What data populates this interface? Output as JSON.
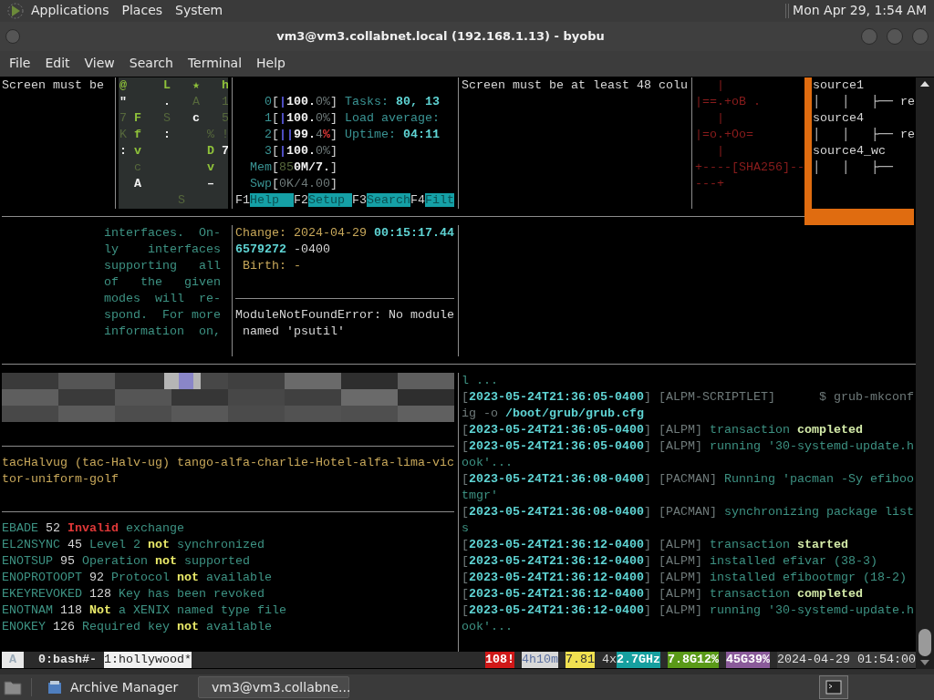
{
  "top_panel": {
    "menus": [
      "Applications",
      "Places",
      "System"
    ],
    "clock": "Mon Apr 29, 1:54 AM"
  },
  "window": {
    "title": "vm3@vm3.collabnet.local (192.168.1.13) - byobu",
    "menu": [
      "File",
      "Edit",
      "View",
      "Search",
      "Terminal",
      "Help"
    ]
  },
  "terminal": {
    "top_panes": [
      {
        "kind": "plain",
        "lines": [
          [
            {
              "text": "Screen must be",
              "kind": "text"
            }
          ]
        ]
      },
      {
        "kind": "shaded",
        "lines": [
          [
            {
              "text": "@     L   ★   h",
              "kind": "lime"
            }
          ],
          [
            {
              "text": "\"     .",
              "kind": "bold"
            },
            {
              "text": "   A   1",
              "kind": "olive"
            }
          ],
          [
            {
              "text": "7 ",
              "kind": "olive"
            },
            {
              "text": "F",
              "kind": "lime"
            },
            {
              "text": "   S   ",
              "kind": "olive"
            },
            {
              "text": "c",
              "kind": "bold"
            },
            {
              "text": "   5",
              "kind": "olive"
            }
          ],
          [
            {
              "text": "K ",
              "kind": "olive"
            },
            {
              "text": "f",
              "kind": "lime"
            },
            {
              "text": "   :",
              "kind": "bold"
            },
            {
              "text": "     % !",
              "kind": "olive"
            }
          ],
          [
            {
              "text": ":",
              "kind": "bold"
            },
            {
              "text": " v         D",
              "kind": "lime"
            },
            {
              "text": " 7",
              "kind": "bold"
            }
          ],
          [
            {
              "text": "  c",
              "kind": "olive"
            },
            {
              "text": "         v",
              "kind": "lime"
            }
          ],
          [
            {
              "text": "  A         –",
              "kind": "bold"
            }
          ],
          [
            {
              "text": "        S",
              "kind": "olive"
            }
          ]
        ]
      },
      {
        "kind": "offset",
        "lines": [
          [
            {
              "text": "    0",
              "kind": "teal"
            },
            {
              "text": "[",
              "kind": "text"
            },
            {
              "text": "|",
              "kind": "blue"
            },
            {
              "text": "100.",
              "kind": "bold"
            },
            {
              "text": "0%",
              "kind": "grey"
            },
            {
              "text": "]",
              "kind": "text"
            },
            {
              "text": " Tasks: ",
              "kind": "teal"
            },
            {
              "text": "80, 13",
              "kind": "cyan"
            }
          ],
          [
            {
              "text": "    1",
              "kind": "teal"
            },
            {
              "text": "[",
              "kind": "text"
            },
            {
              "text": "|",
              "kind": "blue"
            },
            {
              "text": "100.",
              "kind": "bold"
            },
            {
              "text": "0%",
              "kind": "grey"
            },
            {
              "text": "]",
              "kind": "text"
            },
            {
              "text": " Load average:",
              "kind": "teal"
            }
          ],
          [
            {
              "text": "    2",
              "kind": "teal"
            },
            {
              "text": "[",
              "kind": "text"
            },
            {
              "text": "||",
              "kind": "blue"
            },
            {
              "text": "99.",
              "kind": "bold"
            },
            {
              "text": "4",
              "kind": "grey"
            },
            {
              "text": "%",
              "kind": "red"
            },
            {
              "text": "]",
              "kind": "text"
            },
            {
              "text": " Uptime: ",
              "kind": "teal"
            },
            {
              "text": "04:11",
              "kind": "cyan"
            }
          ],
          [
            {
              "text": "    3",
              "kind": "teal"
            },
            {
              "text": "[",
              "kind": "text"
            },
            {
              "text": "|",
              "kind": "blue"
            },
            {
              "text": "100.",
              "kind": "bold"
            },
            {
              "text": "0%",
              "kind": "grey"
            },
            {
              "text": "]",
              "kind": "text"
            }
          ],
          [
            {
              "text": "  Mem",
              "kind": "teal"
            },
            {
              "text": "[",
              "kind": "text"
            },
            {
              "text": "85",
              "kind": "olive"
            },
            {
              "text": "0M/7.",
              "kind": "bold"
            },
            {
              "text": "]",
              "kind": "text"
            }
          ],
          [
            {
              "text": "  Swp",
              "kind": "teal"
            },
            {
              "text": "[",
              "kind": "text"
            },
            {
              "text": "0K/4.00",
              "kind": "grey"
            },
            {
              "text": "]",
              "kind": "text"
            }
          ],
          [
            {
              "text": "F1",
              "kind": "text"
            },
            {
              "text": "Help  ",
              "kind": "key"
            },
            {
              "text": "F2",
              "kind": "text"
            },
            {
              "text": "Setup ",
              "kind": "key"
            },
            {
              "text": "F3",
              "kind": "text"
            },
            {
              "text": "Search",
              "kind": "key"
            },
            {
              "text": "F4",
              "kind": "text"
            },
            {
              "text": "Filt",
              "kind": "key"
            }
          ]
        ]
      },
      {
        "kind": "plain",
        "lines": [
          [
            {
              "text": "Screen must be at least 48 colu",
              "kind": "text"
            }
          ]
        ]
      },
      {
        "kind": "plain",
        "lines": [
          [
            {
              "text": "   |",
              "kind": "darkred"
            }
          ],
          [
            {
              "text": "|==.+oB .",
              "kind": "darkred"
            }
          ],
          [
            {
              "text": "   |",
              "kind": "darkred"
            }
          ],
          [
            {
              "text": "|=o.+Oo=",
              "kind": "darkred"
            }
          ],
          [
            {
              "text": "   |",
              "kind": "darkred"
            }
          ],
          [
            {
              "text": "+----[SHA256]--",
              "kind": "darkred"
            }
          ],
          [
            {
              "text": "---+",
              "kind": "darkred"
            }
          ]
        ]
      }
    ],
    "tree_pane": {
      "lines": [
        [
          {
            "text": "source1",
            "kind": "text"
          }
        ],
        [
          {
            "text": "│   │   ├── re",
            "kind": "text"
          }
        ],
        [
          {
            "text": "source4",
            "kind": "text"
          }
        ],
        [
          {
            "text": "│   │   ├── re",
            "kind": "text"
          }
        ],
        [
          {
            "text": "source4_wc",
            "kind": "text"
          }
        ],
        [
          {
            "text": "│   │   ├──",
            "kind": "text"
          }
        ]
      ]
    },
    "man_pane": {
      "lines": [
        [
          {
            "text": "interfaces.  On-",
            "kind": "dim"
          }
        ],
        [
          {
            "text": "ly    interfaces",
            "kind": "dim"
          }
        ],
        [
          {
            "text": "supporting   all",
            "kind": "dim"
          }
        ],
        [
          {
            "text": "of   the   given",
            "kind": "dim"
          }
        ],
        [
          {
            "text": "modes  will  re-",
            "kind": "dim"
          }
        ],
        [
          {
            "text": "spond.  For more",
            "kind": "dim"
          }
        ],
        [
          {
            "text": "information  on,",
            "kind": "dim"
          }
        ]
      ]
    },
    "stat_pane": {
      "lines": [
        [
          {
            "text": "Change:",
            "kind": "gold"
          },
          {
            "text": " 2024-04-29 ",
            "kind": "gold"
          },
          {
            "text": "00:15:17.44",
            "kind": "cyan"
          }
        ],
        [
          {
            "text": "6579272",
            "kind": "cyan"
          },
          {
            "text": " -0400",
            "kind": "text"
          }
        ],
        [
          {
            "text": " Birth: -",
            "kind": "gold"
          }
        ]
      ]
    },
    "error_pane": {
      "lines": [
        [
          {
            "text": "ModuleNotFoundError: No module",
            "kind": "text"
          }
        ],
        [
          {
            "text": " named 'psutil'",
            "kind": "text"
          }
        ]
      ]
    },
    "word_pane": {
      "lines": [
        [
          {
            "text": "tacHalvug (tac-Halv-ug) tango-alfa-charlie-Hotel-alfa-lima-vic",
            "kind": "gold"
          }
        ],
        [
          {
            "text": "tor-uniform-golf",
            "kind": "gold"
          }
        ]
      ]
    },
    "errno_pane": {
      "lines": [
        [
          {
            "text": "EBADE",
            "kind": "dim"
          },
          {
            "text": " 52 ",
            "kind": "text"
          },
          {
            "text": "Invalid",
            "kind": "red"
          },
          {
            "text": " exchange",
            "kind": "dim"
          }
        ],
        [
          {
            "text": "EL2NSYNC",
            "kind": "dim"
          },
          {
            "text": " 45 ",
            "kind": "text"
          },
          {
            "text": "Level 2 ",
            "kind": "dim"
          },
          {
            "text": "not",
            "kind": "yellow"
          },
          {
            "text": " synchronized",
            "kind": "dim"
          }
        ],
        [
          {
            "text": "ENOTSUP",
            "kind": "dim"
          },
          {
            "text": " 95 ",
            "kind": "text"
          },
          {
            "text": "Operation ",
            "kind": "dim"
          },
          {
            "text": "not",
            "kind": "yellow"
          },
          {
            "text": " supported",
            "kind": "dim"
          }
        ],
        [
          {
            "text": "ENOPROTOOPT",
            "kind": "dim"
          },
          {
            "text": " 92 ",
            "kind": "text"
          },
          {
            "text": "Protocol ",
            "kind": "dim"
          },
          {
            "text": "not",
            "kind": "yellow"
          },
          {
            "text": " available",
            "kind": "dim"
          }
        ],
        [
          {
            "text": "EKEYREVOKED",
            "kind": "dim"
          },
          {
            "text": " 128 ",
            "kind": "text"
          },
          {
            "text": "Key has been revoked",
            "kind": "dim"
          }
        ],
        [
          {
            "text": "ENOTNAM",
            "kind": "dim"
          },
          {
            "text": " 118 ",
            "kind": "text"
          },
          {
            "text": "Not",
            "kind": "yellow"
          },
          {
            "text": " a XENIX named type file",
            "kind": "dim"
          }
        ],
        [
          {
            "text": "ENOKEY",
            "kind": "dim"
          },
          {
            "text": " 126 ",
            "kind": "text"
          },
          {
            "text": "Required key ",
            "kind": "dim"
          },
          {
            "text": "not",
            "kind": "yellow"
          },
          {
            "text": " available",
            "kind": "dim"
          }
        ]
      ]
    },
    "log_pane": {
      "lines": [
        [
          {
            "text": "l ...",
            "kind": "dim"
          }
        ],
        [
          {
            "text": "[",
            "kind": "grey"
          },
          {
            "text": "2023-05-24T21:36:05-0400",
            "kind": "cyan"
          },
          {
            "text": "] [ALPM-SCRIPTLET]      $ grub-mkconf",
            "kind": "grey"
          }
        ],
        [
          {
            "text": "ig -o ",
            "kind": "grey"
          },
          {
            "text": "/boot/grub/grub.cfg",
            "kind": "cyan"
          }
        ],
        [
          {
            "text": "[",
            "kind": "grey"
          },
          {
            "text": "2023-05-24T21:36:05-0400",
            "kind": "cyan"
          },
          {
            "text": "] [ALPM]",
            "kind": "grey"
          },
          {
            "text": " transaction ",
            "kind": "dim"
          },
          {
            "text": "completed",
            "kind": "pale"
          }
        ],
        [
          {
            "text": "[",
            "kind": "grey"
          },
          {
            "text": "2023-05-24T21:36:05-0400",
            "kind": "cyan"
          },
          {
            "text": "] [ALPM]",
            "kind": "grey"
          },
          {
            "text": " running '30-systemd-update.h",
            "kind": "dim"
          }
        ],
        [
          {
            "text": "ook'...",
            "kind": "dim"
          }
        ],
        [
          {
            "text": "[",
            "kind": "grey"
          },
          {
            "text": "2023-05-24T21:36:08-0400",
            "kind": "cyan"
          },
          {
            "text": "] [PACMAN]",
            "kind": "grey"
          },
          {
            "text": " Running 'pacman -Sy efiboo",
            "kind": "dim"
          }
        ],
        [
          {
            "text": "tmgr'",
            "kind": "dim"
          }
        ],
        [
          {
            "text": "[",
            "kind": "grey"
          },
          {
            "text": "2023-05-24T21:36:08-0400",
            "kind": "cyan"
          },
          {
            "text": "] [PACMAN]",
            "kind": "grey"
          },
          {
            "text": " synchronizing package list",
            "kind": "dim"
          }
        ],
        [
          {
            "text": "s",
            "kind": "dim"
          }
        ],
        [
          {
            "text": "[",
            "kind": "grey"
          },
          {
            "text": "2023-05-24T21:36:12-0400",
            "kind": "cyan"
          },
          {
            "text": "] [ALPM]",
            "kind": "grey"
          },
          {
            "text": " transaction ",
            "kind": "dim"
          },
          {
            "text": "started",
            "kind": "pale"
          }
        ],
        [
          {
            "text": "[",
            "kind": "grey"
          },
          {
            "text": "2023-05-24T21:36:12-0400",
            "kind": "cyan"
          },
          {
            "text": "] [ALPM]",
            "kind": "grey"
          },
          {
            "text": " installed efivar (38-3)",
            "kind": "dim"
          }
        ],
        [
          {
            "text": "[",
            "kind": "grey"
          },
          {
            "text": "2023-05-24T21:36:12-0400",
            "kind": "cyan"
          },
          {
            "text": "] [ALPM]",
            "kind": "grey"
          },
          {
            "text": " installed efibootmgr (18-2)",
            "kind": "dim"
          }
        ],
        [
          {
            "text": "[",
            "kind": "grey"
          },
          {
            "text": "2023-05-24T21:36:12-0400",
            "kind": "cyan"
          },
          {
            "text": "] [ALPM]",
            "kind": "grey"
          },
          {
            "text": " transaction ",
            "kind": "dim"
          },
          {
            "text": "completed",
            "kind": "pale"
          }
        ],
        [
          {
            "text": "[",
            "kind": "grey"
          },
          {
            "text": "2023-05-24T21:36:12-0400",
            "kind": "cyan"
          },
          {
            "text": "] [ALPM]",
            "kind": "grey"
          },
          {
            "text": " running '30-systemd-update.h",
            "kind": "dim"
          }
        ],
        [
          {
            "text": "ook'...",
            "kind": "dim"
          }
        ]
      ]
    }
  },
  "status_bar": {
    "session": "A",
    "windows": [
      {
        "label": "0:bash#-",
        "selected": false
      },
      {
        "label": "1:hollywood*",
        "selected": true
      }
    ],
    "indicators": [
      {
        "text": "108!",
        "kind": "alert"
      },
      {
        "text": "4h10m",
        "kind": "silver"
      },
      {
        "text": "7.81",
        "kind": "load"
      },
      {
        "text": "4x",
        "kind": "plain"
      },
      {
        "text": "2.7GHz",
        "kind": "cpu"
      },
      {
        "text": "7.8G12%",
        "kind": "mem"
      },
      {
        "text": "45G39%",
        "kind": "disk"
      },
      {
        "text": "2024-04-29 01:54:00",
        "kind": "clock"
      }
    ]
  },
  "taskbar": {
    "tasks": [
      {
        "label": "Archive Manager",
        "selected": false
      },
      {
        "label": "vm3@vm3.collabne...",
        "selected": true
      }
    ]
  }
}
